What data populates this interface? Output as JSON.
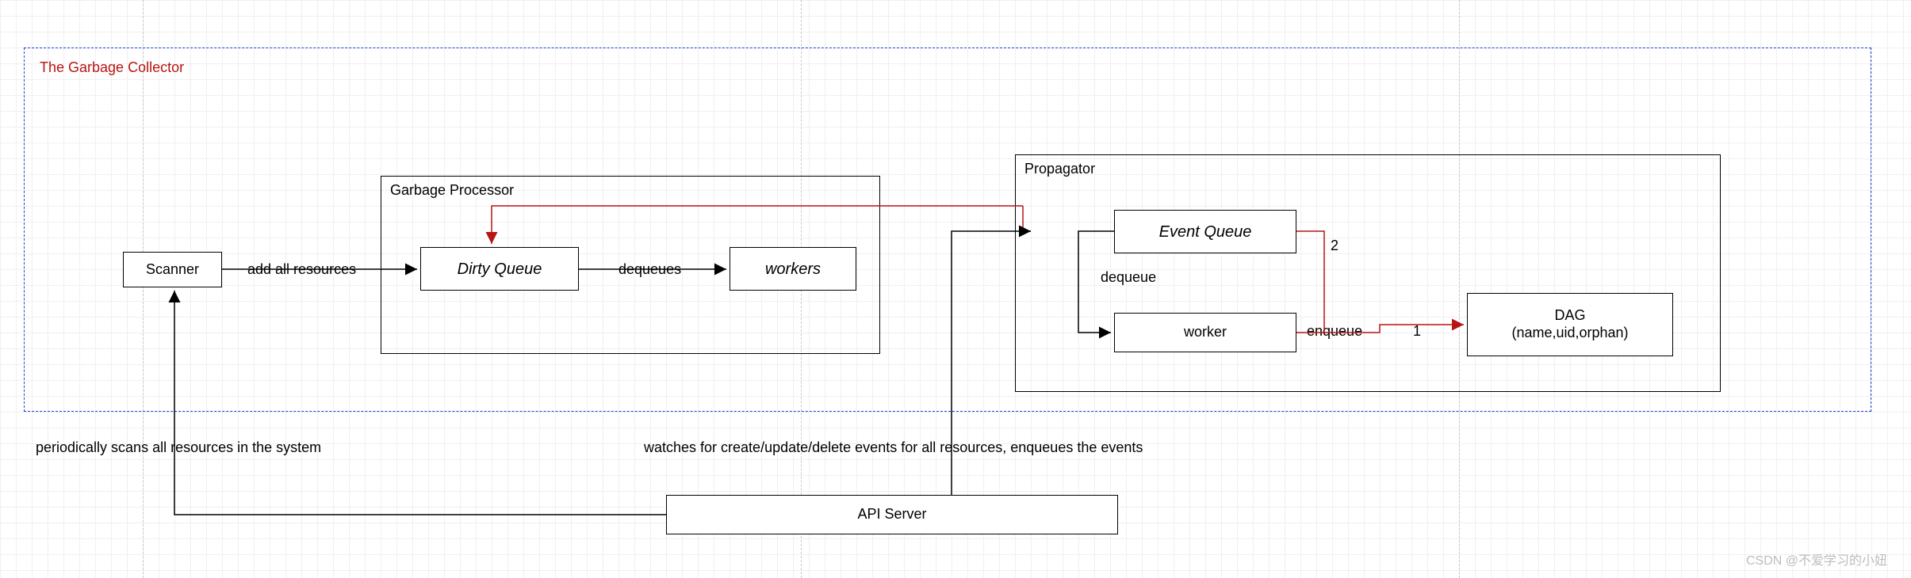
{
  "title": "The Garbage Collector",
  "groups": {
    "garbage_processor": {
      "label": "Garbage Processor"
    },
    "propagator": {
      "label": "Propagator"
    }
  },
  "nodes": {
    "scanner": {
      "label": "Scanner"
    },
    "dirty_queue": {
      "label": "Dirty Queue"
    },
    "workers": {
      "label": "workers"
    },
    "event_queue": {
      "label": "Event Queue"
    },
    "worker": {
      "label": "worker"
    },
    "dag": {
      "label": "DAG\n(name,uid,orphan)"
    },
    "api_server": {
      "label": "API Server"
    }
  },
  "edges": {
    "add_all_resources": "add all resources",
    "dequeues": "dequeues",
    "dequeue": "dequeue",
    "enqueue": "enqueue",
    "one": "1",
    "two": "2"
  },
  "annotations": {
    "scanner_note": "periodically scans all resources in the system",
    "watch_note": "watches for create/update/delete events for all resources, enqueues the events"
  },
  "watermark": "CSDN @不爱学习的小妞",
  "colors": {
    "outer_dash": "#1a3fd6",
    "title": "#b81414",
    "red_arrow": "#b81414",
    "black": "#000000"
  }
}
